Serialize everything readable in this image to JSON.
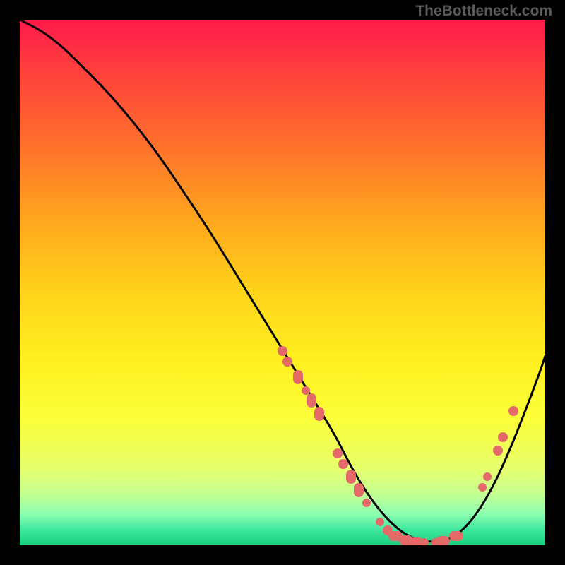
{
  "watermark": "TheBottleneck.com",
  "colors": {
    "background": "#000000",
    "curve": "#000000",
    "dot": "#e46a6a",
    "gradient_top": "#ff1a4a",
    "gradient_bottom": "#18d080"
  },
  "chart_data": {
    "type": "line",
    "title": "",
    "xlabel": "",
    "ylabel": "",
    "xlim": [
      0,
      100
    ],
    "ylim": [
      0,
      100
    ],
    "grid": false,
    "legend": false,
    "curve": {
      "name": "bottleneck-curve",
      "x": [
        0,
        4,
        8,
        12,
        16,
        20,
        24,
        28,
        32,
        36,
        40,
        44,
        48,
        52,
        56,
        60,
        63,
        66,
        69,
        72,
        75,
        78,
        81,
        84,
        87,
        90,
        93,
        96,
        99,
        100
      ],
      "y": [
        100,
        98,
        95,
        91,
        87,
        82.5,
        77.5,
        72,
        66,
        60,
        53.5,
        47,
        40.5,
        34,
        27.5,
        21,
        15,
        10,
        6,
        3,
        1.2,
        0.6,
        0.8,
        2.5,
        6,
        11,
        17.5,
        25,
        33,
        36
      ]
    },
    "markers": [
      {
        "x": 50.0,
        "y": 37.0,
        "size": "med"
      },
      {
        "x": 51.0,
        "y": 35.0,
        "size": "med"
      },
      {
        "x": 53.0,
        "y": 32.0,
        "size": "tall"
      },
      {
        "x": 54.5,
        "y": 29.5,
        "size": "small"
      },
      {
        "x": 55.5,
        "y": 27.5,
        "size": "tall"
      },
      {
        "x": 57.0,
        "y": 25.0,
        "size": "tall"
      },
      {
        "x": 60.5,
        "y": 17.5,
        "size": "med"
      },
      {
        "x": 61.5,
        "y": 15.5,
        "size": "med"
      },
      {
        "x": 63.0,
        "y": 13.0,
        "size": "tall"
      },
      {
        "x": 64.5,
        "y": 10.5,
        "size": "tall"
      },
      {
        "x": 66.0,
        "y": 8.0,
        "size": "small"
      },
      {
        "x": 68.5,
        "y": 4.5,
        "size": "small"
      },
      {
        "x": 70.0,
        "y": 2.8,
        "size": "med"
      },
      {
        "x": 71.5,
        "y": 1.8,
        "size": "wide"
      },
      {
        "x": 73.5,
        "y": 1.0,
        "size": "wide"
      },
      {
        "x": 75.5,
        "y": 0.6,
        "size": "wide"
      },
      {
        "x": 77.0,
        "y": 0.5,
        "size": "small"
      },
      {
        "x": 79.0,
        "y": 0.6,
        "size": "small"
      },
      {
        "x": 80.5,
        "y": 0.8,
        "size": "wide"
      },
      {
        "x": 83.0,
        "y": 1.8,
        "size": "wide"
      },
      {
        "x": 88.0,
        "y": 11.0,
        "size": "small"
      },
      {
        "x": 89.0,
        "y": 13.0,
        "size": "small"
      },
      {
        "x": 91.0,
        "y": 18.0,
        "size": "med"
      },
      {
        "x": 92.0,
        "y": 20.5,
        "size": "med"
      },
      {
        "x": 94.0,
        "y": 25.5,
        "size": "med"
      }
    ]
  }
}
